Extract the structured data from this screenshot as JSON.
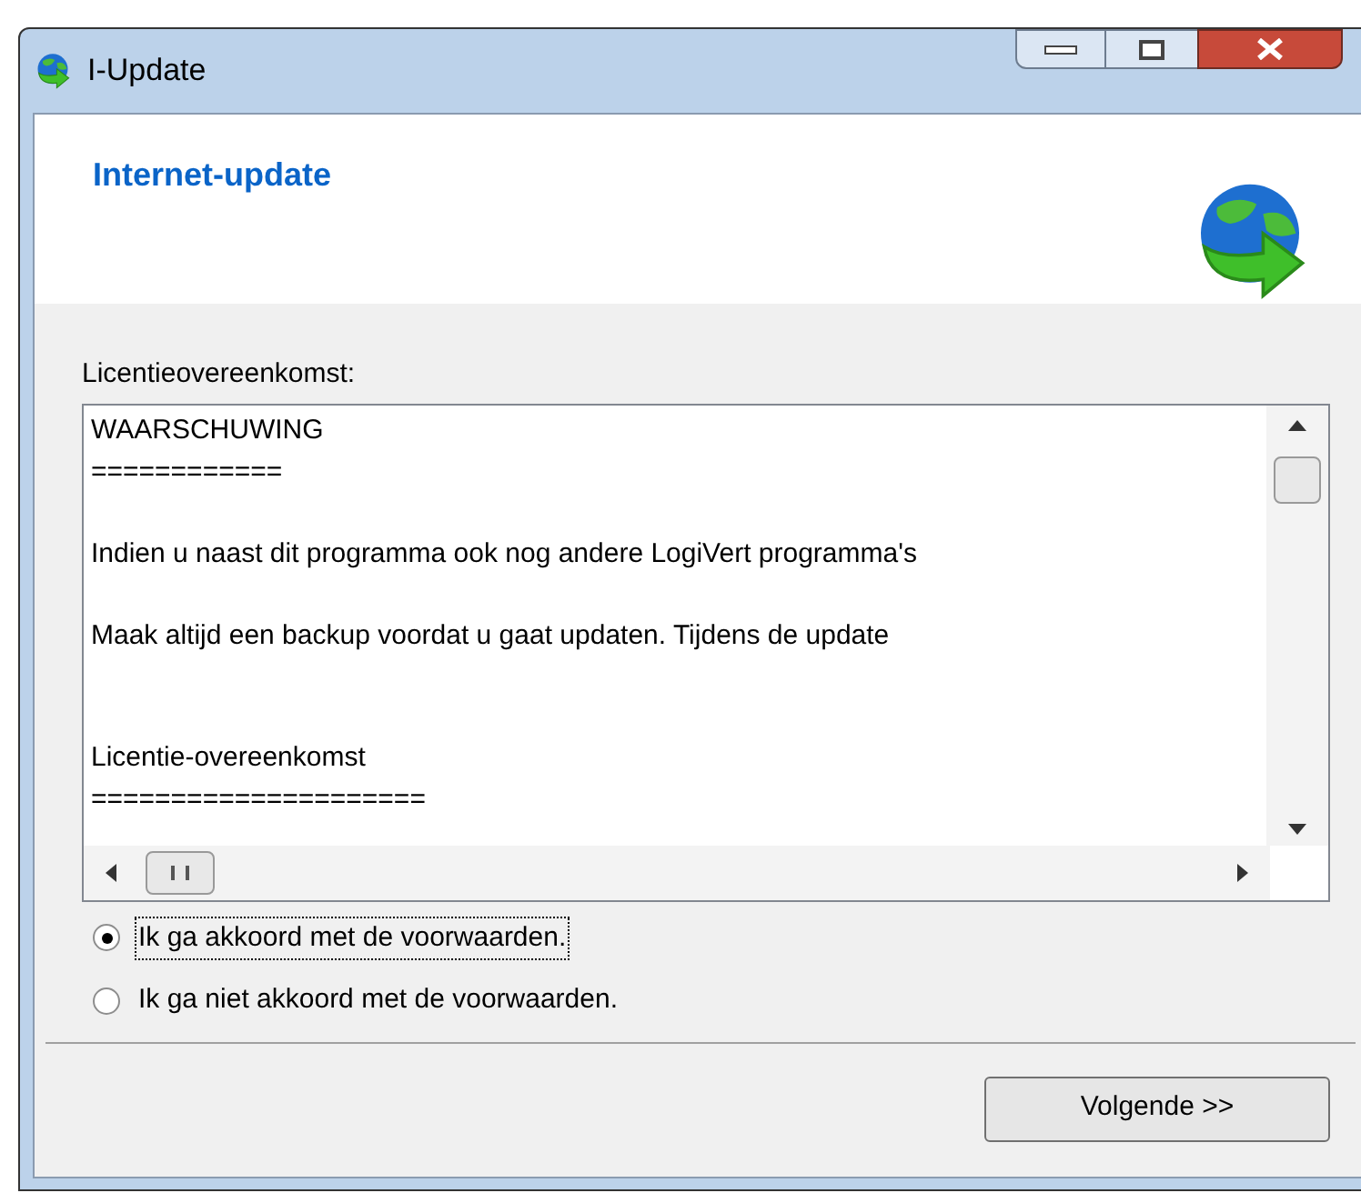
{
  "window": {
    "title": "I-Update"
  },
  "header": {
    "title": "Internet-update"
  },
  "license": {
    "label": "Licentieovereenkomst:",
    "paragraphs": [
      [
        "WAARSCHUWING",
        "============"
      ],
      [
        "Indien u naast dit programma ook nog andere LogiVert programma's"
      ],
      [
        "Maak altijd een backup voordat u gaat updaten. Tijdens de update"
      ],
      [
        "Licentie-overeenkomst",
        "====================="
      ]
    ]
  },
  "options": [
    {
      "label": "Ik ga akkoord met de voorwaarden.",
      "selected": true
    },
    {
      "label": "Ik ga niet akkoord met de voorwaarden.",
      "selected": false
    }
  ],
  "buttons": [
    "Volgende >>"
  ]
}
